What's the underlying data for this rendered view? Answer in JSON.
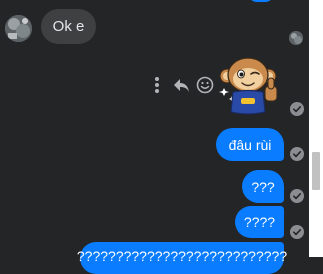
{
  "conversation": {
    "incoming": {
      "text": "Ok e"
    },
    "outgoing": [
      {
        "text": "đâu rùi"
      },
      {
        "text": "???"
      },
      {
        "text": "????"
      },
      {
        "text": "???????????????????????????"
      }
    ]
  },
  "message_actions": {
    "more_icon": "more-vertical-icon",
    "reply_icon": "reply-icon",
    "react_icon": "smiley-icon"
  },
  "colors": {
    "background": "#242526",
    "incoming_bubble": "#3e4042",
    "outgoing_bubble": "#0a7cff",
    "read_check": "#8a8d91"
  }
}
